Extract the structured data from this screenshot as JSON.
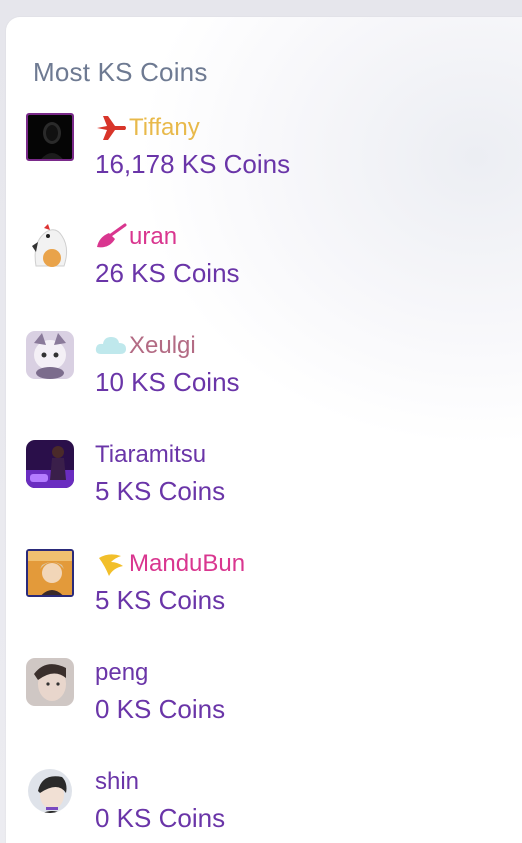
{
  "panel": {
    "title": "Most KS Coins"
  },
  "leaders": [
    {
      "name": "Tiffany",
      "coins": "16,178 KS Coins",
      "name_color": "#e8b94a",
      "badge": "airplane-icon"
    },
    {
      "name": "uran",
      "coins": "26 KS Coins",
      "name_color": "#d9368f",
      "badge": "broom-icon"
    },
    {
      "name": "Xeulgi",
      "coins": "10 KS Coins",
      "name_color": "#b36b84",
      "badge": "cloud-icon"
    },
    {
      "name": "Tiaramitsu",
      "coins": "5 KS Coins",
      "name_color": "#6a35a8",
      "badge": ""
    },
    {
      "name": "ManduBun",
      "coins": "5 KS Coins",
      "name_color": "#d9368f",
      "badge": "banana-icon"
    },
    {
      "name": "peng",
      "coins": "0 KS Coins",
      "name_color": "#6a35a8",
      "badge": ""
    },
    {
      "name": "shin",
      "coins": "0 KS Coins",
      "name_color": "#6a35a8",
      "badge": ""
    }
  ]
}
